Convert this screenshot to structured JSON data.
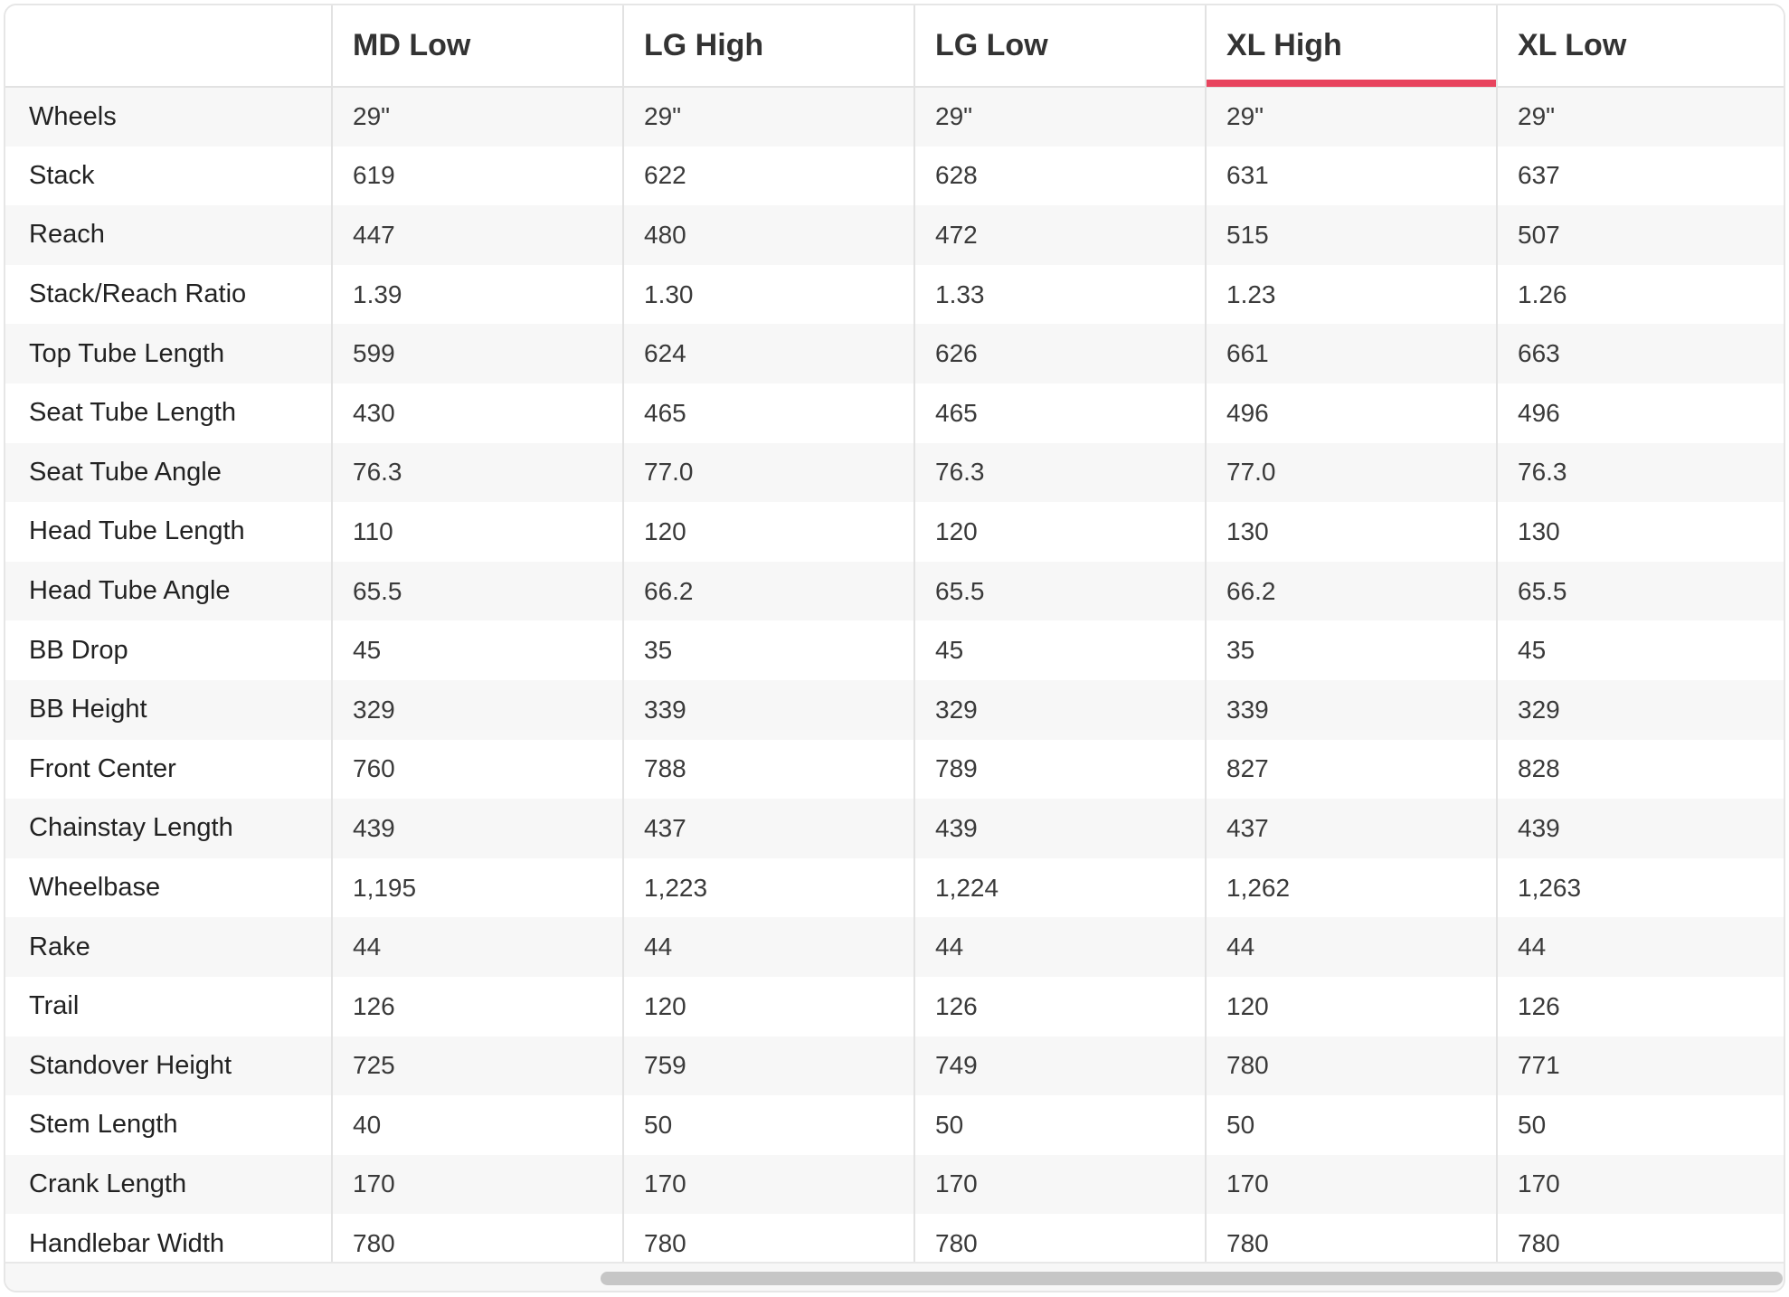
{
  "columns": [
    "",
    "MD Low",
    "LG High",
    "LG Low",
    "XL High",
    "XL Low"
  ],
  "active_column": "XL High",
  "accent_color": "#e8445e",
  "rows": [
    {
      "label": "Wheels",
      "values": [
        "29\"",
        "29\"",
        "29\"",
        "29\"",
        "29\""
      ]
    },
    {
      "label": "Stack",
      "values": [
        "619",
        "622",
        "628",
        "631",
        "637"
      ]
    },
    {
      "label": "Reach",
      "values": [
        "447",
        "480",
        "472",
        "515",
        "507"
      ]
    },
    {
      "label": "Stack/Reach Ratio",
      "values": [
        "1.39",
        "1.30",
        "1.33",
        "1.23",
        "1.26"
      ]
    },
    {
      "label": "Top Tube Length",
      "values": [
        "599",
        "624",
        "626",
        "661",
        "663"
      ]
    },
    {
      "label": "Seat Tube Length",
      "values": [
        "430",
        "465",
        "465",
        "496",
        "496"
      ]
    },
    {
      "label": "Seat Tube Angle",
      "values": [
        "76.3",
        "77.0",
        "76.3",
        "77.0",
        "76.3"
      ]
    },
    {
      "label": "Head Tube Length",
      "values": [
        "110",
        "120",
        "120",
        "130",
        "130"
      ]
    },
    {
      "label": "Head Tube Angle",
      "values": [
        "65.5",
        "66.2",
        "65.5",
        "66.2",
        "65.5"
      ]
    },
    {
      "label": "BB Drop",
      "values": [
        "45",
        "35",
        "45",
        "35",
        "45"
      ]
    },
    {
      "label": "BB Height",
      "values": [
        "329",
        "339",
        "329",
        "339",
        "329"
      ]
    },
    {
      "label": "Front Center",
      "values": [
        "760",
        "788",
        "789",
        "827",
        "828"
      ]
    },
    {
      "label": "Chainstay Length",
      "values": [
        "439",
        "437",
        "439",
        "437",
        "439"
      ]
    },
    {
      "label": "Wheelbase",
      "values": [
        "1,195",
        "1,223",
        "1,224",
        "1,262",
        "1,263"
      ]
    },
    {
      "label": "Rake",
      "values": [
        "44",
        "44",
        "44",
        "44",
        "44"
      ]
    },
    {
      "label": "Trail",
      "values": [
        "126",
        "120",
        "126",
        "120",
        "126"
      ]
    },
    {
      "label": "Standover Height",
      "values": [
        "725",
        "759",
        "749",
        "780",
        "771"
      ]
    },
    {
      "label": "Stem Length",
      "values": [
        "40",
        "50",
        "50",
        "50",
        "50"
      ]
    },
    {
      "label": "Crank Length",
      "values": [
        "170",
        "170",
        "170",
        "170",
        "170"
      ]
    },
    {
      "label": "Handlebar Width",
      "values": [
        "780",
        "780",
        "780",
        "780",
        "780"
      ]
    }
  ]
}
